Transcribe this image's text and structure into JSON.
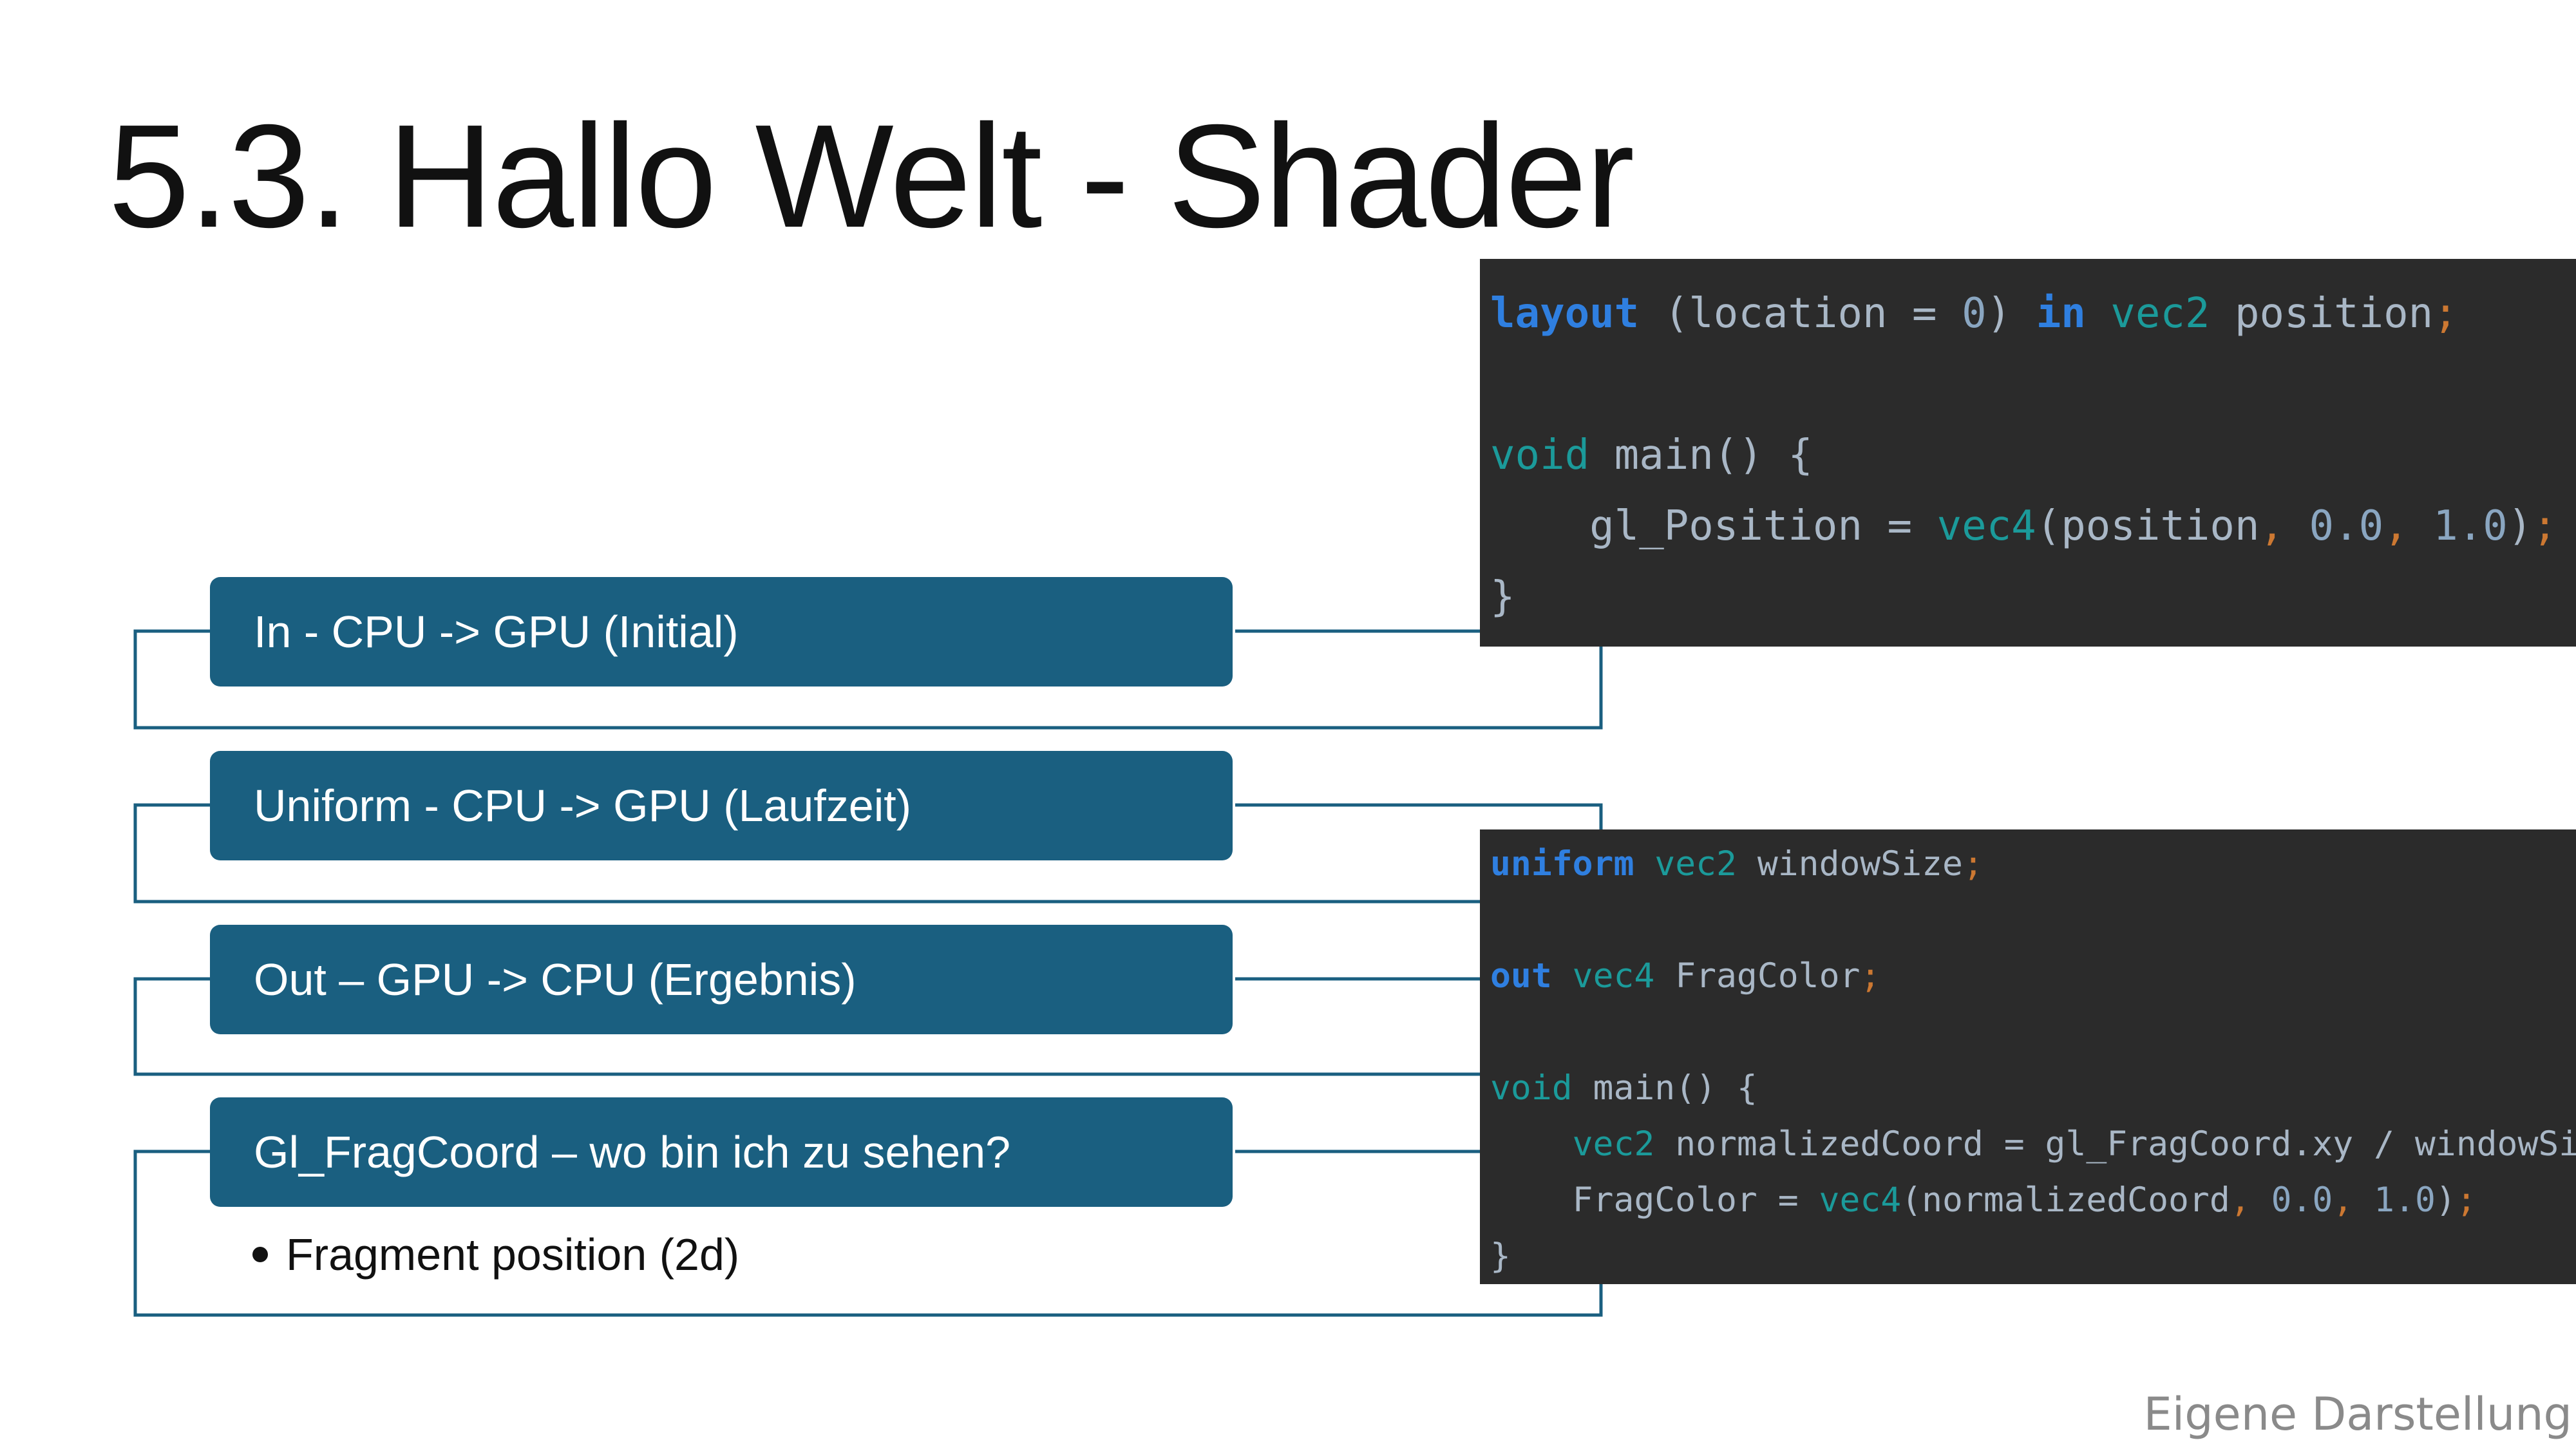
{
  "slide": {
    "title": "5.3. Hallo Welt - Shader",
    "items": [
      {
        "label": "In - CPU -> GPU (Initial)"
      },
      {
        "label": "Uniform - CPU -> GPU (Laufzeit)"
      },
      {
        "label": "Out – GPU -> CPU (Ergebnis)"
      },
      {
        "label": "Gl_FragCoord – wo bin ich zu sehen?"
      }
    ],
    "bullet": "Fragment position (2d)",
    "footer": "Eigene Darstellung"
  },
  "code_vertex": {
    "l1": {
      "kw1": "layout",
      "p1": " (location = ",
      "n1": "0",
      "p2": ") ",
      "kw2": "in",
      "sp": " ",
      "t1": "vec2",
      "v1": " position",
      "semi": ";"
    },
    "l3": {
      "kw": "void",
      "rest": " main() {"
    },
    "l4": {
      "indent": "    gl_Position = ",
      "t1": "vec4",
      "p1": "(position",
      "c1": ",",
      "n1": " 0.0",
      "c2": ",",
      "n2": " 1.0",
      "p2": ")",
      "semi": ";"
    },
    "l5": {
      "brace": "}"
    }
  },
  "code_fragment": {
    "l1": {
      "kw": "uniform",
      "sp": " ",
      "t1": "vec2",
      "v1": " windowSize",
      "semi": ";"
    },
    "l3": {
      "kw": "out",
      "sp": " ",
      "t1": "vec4",
      "v1": " FragColor",
      "semi": ";"
    },
    "l5": {
      "kw": "void",
      "rest": " main() {"
    },
    "l6": {
      "indent": "    ",
      "t1": "vec2",
      "rest": " normalizedCoord = gl_FragCoord.xy / windowSize",
      "semi": ";"
    },
    "l7": {
      "indent": "    FragColor = ",
      "t1": "vec4",
      "p1": "(normalizedCoord",
      "c1": ",",
      "n1": " 0.0",
      "c2": ",",
      "n2": " 1.0",
      "p2": ")",
      "semi": ";"
    },
    "l8": {
      "brace": "}"
    }
  },
  "colors": {
    "box": "#1a5f80",
    "connector": "#1a5f80",
    "code_bg": "#2b2b2b",
    "keyword": "#2f7fe0",
    "type": "#1b9a9a"
  }
}
